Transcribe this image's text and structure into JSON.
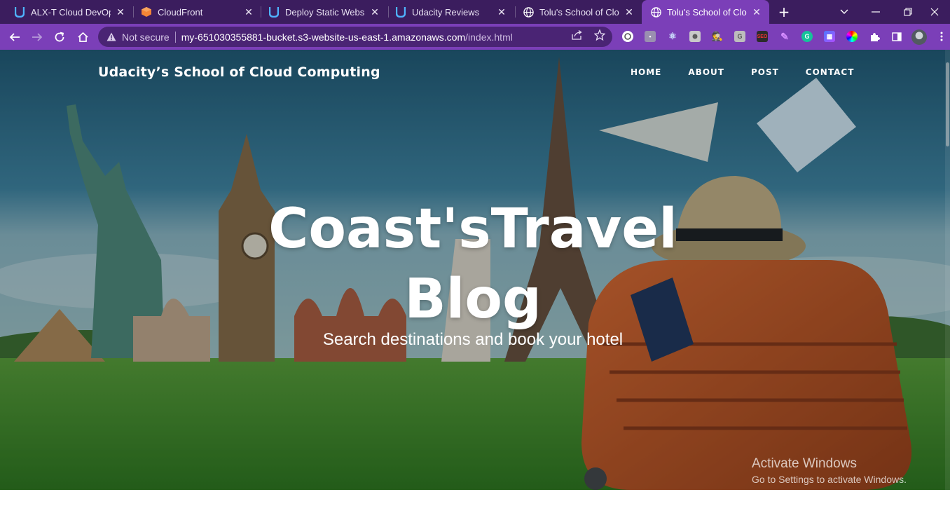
{
  "browser": {
    "tabs": [
      {
        "title": "ALX-T Cloud DevOps E",
        "icon": "udacity-icon",
        "active": false
      },
      {
        "title": "CloudFront",
        "icon": "aws-cloudfront-icon",
        "active": false
      },
      {
        "title": "Deploy Static Website",
        "icon": "udacity-icon",
        "active": false
      },
      {
        "title": "Udacity Reviews",
        "icon": "udacity-icon",
        "active": false
      },
      {
        "title": "Tolu's School of Cloud",
        "icon": "globe-icon",
        "active": false
      },
      {
        "title": "Tolu's School of Cloud",
        "icon": "globe-icon",
        "active": true
      }
    ],
    "address": {
      "security_label": "Not secure",
      "host": "my-651030355881-bucket.s3-website-us-east-1.amazonaws.com",
      "path": "/index.html"
    },
    "colors": {
      "tabstrip": "#3b1d5e",
      "toolbar": "#7b3fb8",
      "omnibox": "#4a2474"
    }
  },
  "site": {
    "brand": "Udacity’s School of Cloud Computing",
    "nav": [
      "HOME",
      "ABOUT",
      "POST",
      "CONTACT"
    ],
    "hero_title_line1": "Coast'sTravel",
    "hero_title_line2": "Blog",
    "hero_subtitle": "Search destinations and book your hotel",
    "hero_image": "world-landmarks-travel-collage"
  },
  "os_watermark": {
    "line1": "Activate Windows",
    "line2": "Go to Settings to activate Windows."
  }
}
